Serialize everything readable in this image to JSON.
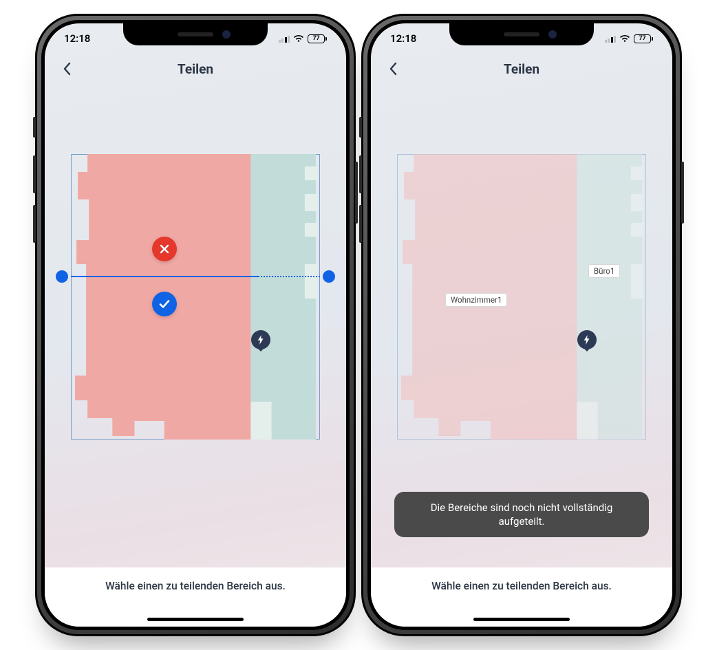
{
  "status": {
    "time": "12:18",
    "battery": "77"
  },
  "header": {
    "title": "Teilen"
  },
  "footer": {
    "hint": "Wähle einen zu teilenden Bereich aus."
  },
  "right_phone": {
    "rooms": {
      "a": "Wohnzimmer1",
      "b": "Büro1"
    },
    "toast": "Die Bereiche sind noch nicht vollständig aufgeteilt."
  },
  "icons": {
    "back": "back-chevron",
    "wifi": "wifi",
    "signal": "cell-signal",
    "battery": "battery",
    "cancel": "close",
    "confirm": "check",
    "dock": "charge-bolt"
  }
}
